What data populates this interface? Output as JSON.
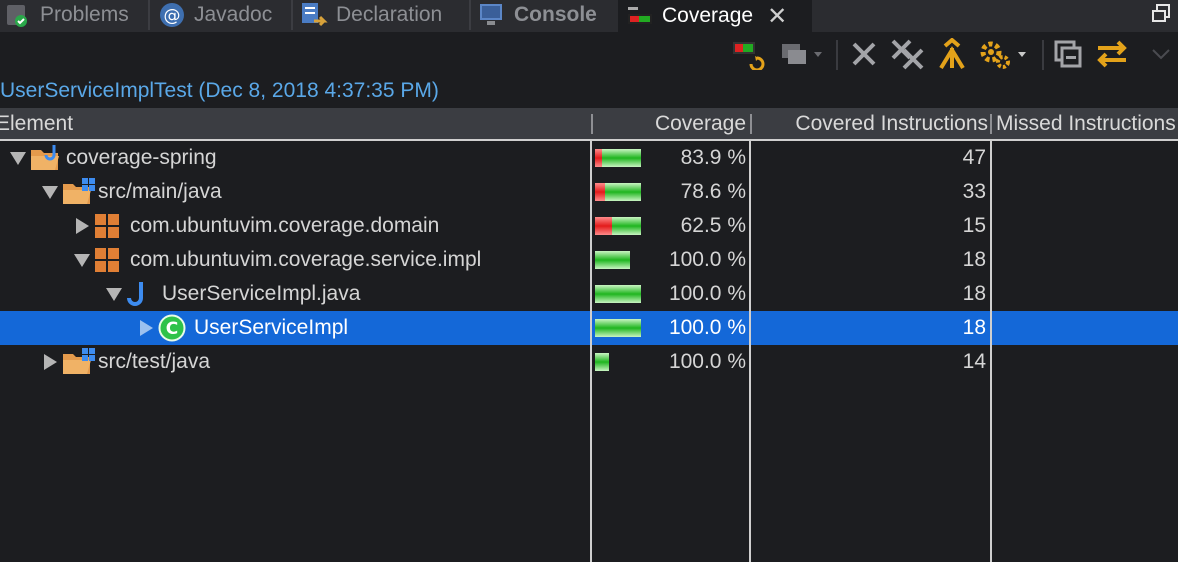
{
  "tabs": [
    {
      "label": "Problems",
      "icon": "problems-icon",
      "active": false
    },
    {
      "label": "Javadoc",
      "icon": "javadoc-icon",
      "active": false
    },
    {
      "label": "Declaration",
      "icon": "declaration-icon",
      "active": false
    },
    {
      "label": "Console",
      "icon": "console-icon",
      "active": false
    },
    {
      "label": "Coverage",
      "icon": "coverage-icon",
      "active": true
    }
  ],
  "close_glyph": "✕",
  "toolbar": {
    "icons": [
      "relaunch-coverage-icon",
      "merge-sessions-icon",
      "remove-session-icon",
      "remove-all-sessions-icon",
      "collapse-icon",
      "settings-icon",
      "collapse-all-icon",
      "link-with-editor-icon",
      "view-menu-icon"
    ]
  },
  "session_title": "UserServiceImplTest (Dec 8, 2018 4:37:35 PM)",
  "columns": {
    "element": "Element",
    "coverage": "Coverage",
    "covered": "Covered Instructions",
    "missed": "Missed Instructions"
  },
  "colors": {
    "selection": "#1468d8",
    "bar_red": "#e21b1b",
    "bar_green": "#1fb51f",
    "session_title": "#5aa8e8"
  },
  "rows": [
    {
      "label": "coverage-spring",
      "icon": "project-icon",
      "expanded": true,
      "level": 0,
      "coverage": "83.9 %",
      "covered": "47",
      "coverage_fraction": 0.839,
      "bar_scale": 1.0
    },
    {
      "label": "src/main/java",
      "icon": "source-folder-icon",
      "expanded": true,
      "level": 1,
      "coverage": "78.6 %",
      "covered": "33",
      "coverage_fraction": 0.786,
      "bar_scale": 1.0
    },
    {
      "label": "com.ubuntuvim.coverage.domain",
      "icon": "package-icon",
      "expanded": false,
      "level": 2,
      "coverage": "62.5 %",
      "covered": "15",
      "coverage_fraction": 0.625,
      "bar_scale": 1.0
    },
    {
      "label": "com.ubuntuvim.coverage.service.impl",
      "icon": "package-icon",
      "expanded": true,
      "level": 2,
      "coverage": "100.0 %",
      "covered": "18",
      "coverage_fraction": 1.0,
      "bar_scale": 0.75
    },
    {
      "label": "UserServiceImpl.java",
      "icon": "java-file-icon",
      "expanded": true,
      "level": 3,
      "coverage": "100.0 %",
      "covered": "18",
      "coverage_fraction": 1.0,
      "bar_scale": 1.0
    },
    {
      "label": "UserServiceImpl",
      "icon": "class-icon",
      "expanded": false,
      "level": 4,
      "coverage": "100.0 %",
      "covered": "18",
      "coverage_fraction": 1.0,
      "bar_scale": 1.0,
      "selected": true
    },
    {
      "label": "src/test/java",
      "icon": "source-folder-icon",
      "expanded": false,
      "level": 1,
      "coverage": "100.0 %",
      "covered": "14",
      "coverage_fraction": 1.0,
      "bar_scale": 0.3
    }
  ]
}
